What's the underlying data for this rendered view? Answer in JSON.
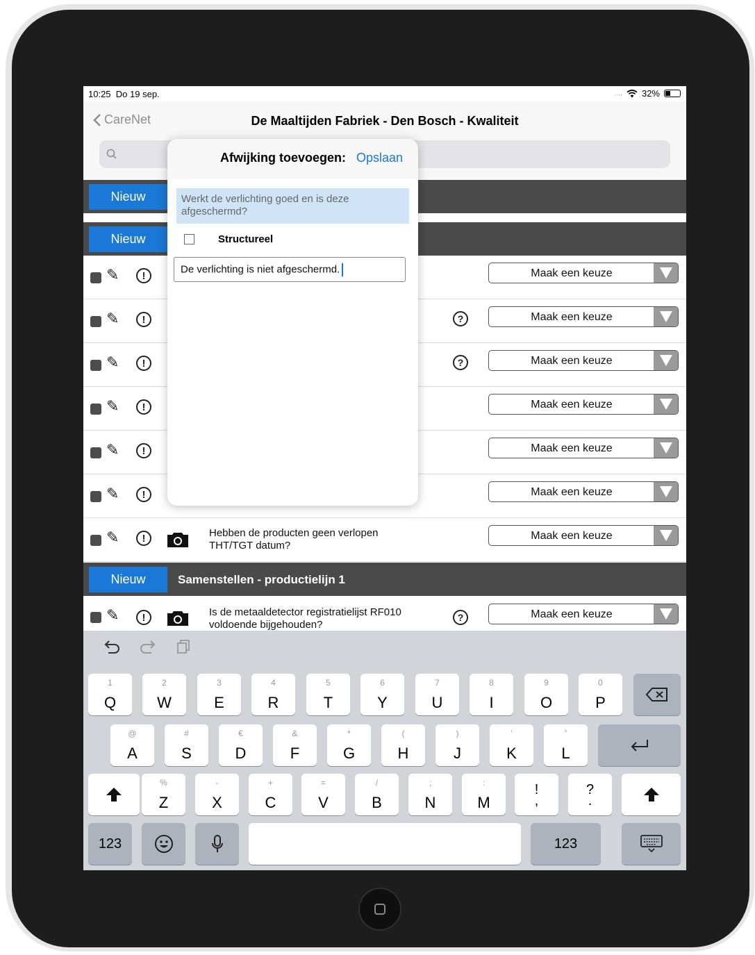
{
  "status": {
    "time": "10:25",
    "date": "Do 19 sep.",
    "signal": "....",
    "wifi_icon": "wifi-icon",
    "battery": "32%"
  },
  "nav": {
    "back": "CareNet",
    "title": "De Maaltijden Fabriek - Den Bosch - Kwaliteit"
  },
  "sections": [
    {
      "button": "Nieuw",
      "title": ""
    },
    {
      "button": "Nieuw",
      "title": ""
    },
    {
      "button": "Nieuw",
      "title": "Samenstellen - productielijn 1"
    }
  ],
  "rows": [
    {
      "question": "",
      "select": "Maak een keuze"
    },
    {
      "question": "",
      "select": "Maak een keuze"
    },
    {
      "question": "",
      "select": "Maak een keuze"
    },
    {
      "question": "",
      "select": "Maak een keuze"
    },
    {
      "question": "",
      "select": "Maak een keuze"
    },
    {
      "question": "",
      "select": "Maak een keuze"
    },
    {
      "question": "Hebben de producten geen verlopen THT/TGT datum?",
      "select": "Maak een keuze"
    },
    {
      "question": "Is de metaaldetector registratielijst RF010 voldoende bijgehouden?",
      "select": "Maak een keuze"
    }
  ],
  "popover": {
    "title": "Afwijking toevoegen:",
    "save": "Opslaan",
    "question": "Werkt de verlichting goed en is deze afgeschermd?",
    "checkbox_label": "Structureel",
    "input_value": "De verlichting is niet afgeschermd."
  },
  "keyboard": {
    "row1": [
      {
        "k": "Q",
        "s": "1"
      },
      {
        "k": "W",
        "s": "2"
      },
      {
        "k": "E",
        "s": "3"
      },
      {
        "k": "R",
        "s": "4"
      },
      {
        "k": "T",
        "s": "5"
      },
      {
        "k": "Y",
        "s": "6"
      },
      {
        "k": "U",
        "s": "7"
      },
      {
        "k": "I",
        "s": "8"
      },
      {
        "k": "O",
        "s": "9"
      },
      {
        "k": "P",
        "s": "0"
      }
    ],
    "row2": [
      {
        "k": "A",
        "s": "@"
      },
      {
        "k": "S",
        "s": "#"
      },
      {
        "k": "D",
        "s": "€"
      },
      {
        "k": "F",
        "s": "&"
      },
      {
        "k": "G",
        "s": "*"
      },
      {
        "k": "H",
        "s": "("
      },
      {
        "k": "J",
        "s": ")"
      },
      {
        "k": "K",
        "s": "’"
      },
      {
        "k": "L",
        "s": "”"
      }
    ],
    "row3": [
      {
        "k": "Z",
        "s": "%"
      },
      {
        "k": "X",
        "s": "-"
      },
      {
        "k": "C",
        "s": "+"
      },
      {
        "k": "V",
        "s": "="
      },
      {
        "k": "B",
        "s": "/"
      },
      {
        "k": "N",
        "s": ";"
      },
      {
        "k": "M",
        "s": ":"
      },
      {
        "k": "!",
        "s": ""
      },
      {
        "k": "?",
        "s": ""
      }
    ],
    "k123": "123",
    "k123_right": "123"
  }
}
